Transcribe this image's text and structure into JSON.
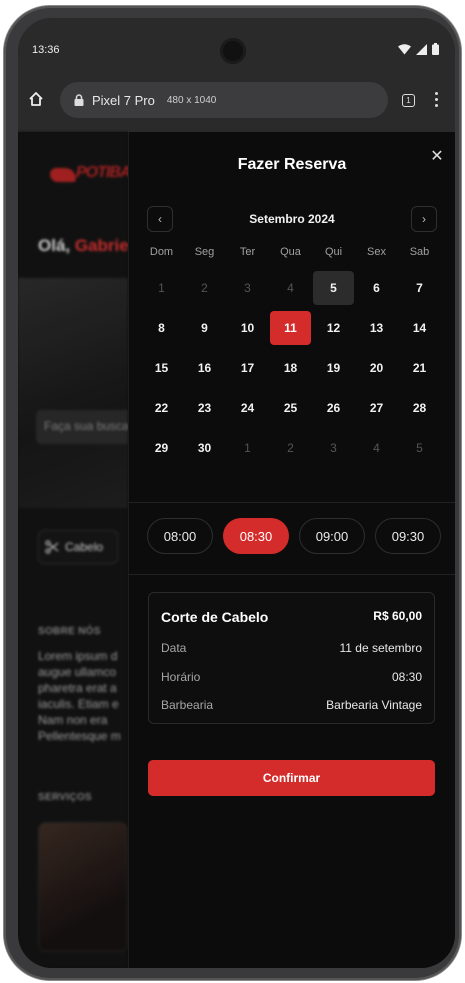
{
  "status_bar": {
    "time": "13:36"
  },
  "browser": {
    "device_name": "Pixel 7 Pro",
    "viewport": "480 x 1040",
    "tab_count": "1"
  },
  "background_page": {
    "logo": "POTIBA",
    "greeting": "Olá,",
    "user_name": "Gabrie",
    "search_placeholder": "Faça sua busca",
    "category": "Cabelo",
    "about_title": "SOBRE NÓS",
    "about_text": "Lorem ipsum d\naugue ullamco\npharetra erat a\niaculis. Etiam e\nNam non era\nPellentesque m",
    "services_title": "SERVIÇOS"
  },
  "sheet": {
    "title": "Fazer Reserva",
    "calendar": {
      "month": "Setembro 2024",
      "weekdays": [
        "Dom",
        "Seg",
        "Ter",
        "Qua",
        "Qui",
        "Sex",
        "Sab"
      ],
      "days": [
        {
          "d": "1",
          "state": "muted"
        },
        {
          "d": "2",
          "state": "muted"
        },
        {
          "d": "3",
          "state": "muted"
        },
        {
          "d": "4",
          "state": "muted"
        },
        {
          "d": "5",
          "state": "today"
        },
        {
          "d": "6",
          "state": ""
        },
        {
          "d": "7",
          "state": ""
        },
        {
          "d": "8",
          "state": ""
        },
        {
          "d": "9",
          "state": ""
        },
        {
          "d": "10",
          "state": ""
        },
        {
          "d": "11",
          "state": "sel"
        },
        {
          "d": "12",
          "state": ""
        },
        {
          "d": "13",
          "state": ""
        },
        {
          "d": "14",
          "state": ""
        },
        {
          "d": "15",
          "state": ""
        },
        {
          "d": "16",
          "state": ""
        },
        {
          "d": "17",
          "state": ""
        },
        {
          "d": "18",
          "state": ""
        },
        {
          "d": "19",
          "state": ""
        },
        {
          "d": "20",
          "state": ""
        },
        {
          "d": "21",
          "state": ""
        },
        {
          "d": "22",
          "state": ""
        },
        {
          "d": "23",
          "state": ""
        },
        {
          "d": "24",
          "state": ""
        },
        {
          "d": "25",
          "state": ""
        },
        {
          "d": "26",
          "state": ""
        },
        {
          "d": "27",
          "state": ""
        },
        {
          "d": "28",
          "state": ""
        },
        {
          "d": "29",
          "state": ""
        },
        {
          "d": "30",
          "state": ""
        },
        {
          "d": "1",
          "state": "muted"
        },
        {
          "d": "2",
          "state": "muted"
        },
        {
          "d": "3",
          "state": "muted"
        },
        {
          "d": "4",
          "state": "muted"
        },
        {
          "d": "5",
          "state": "muted"
        }
      ]
    },
    "times": [
      {
        "label": "08:00",
        "selected": false
      },
      {
        "label": "08:30",
        "selected": true
      },
      {
        "label": "09:00",
        "selected": false
      },
      {
        "label": "09:30",
        "selected": false
      }
    ],
    "summary": {
      "service": "Corte de Cabelo",
      "price": "R$ 60,00",
      "rows": [
        {
          "label": "Data",
          "value": "11 de setembro"
        },
        {
          "label": "Horário",
          "value": "08:30"
        },
        {
          "label": "Barbearia",
          "value": "Barbearia Vintage"
        }
      ]
    },
    "confirm_label": "Confirmar"
  },
  "colors": {
    "accent": "#d42b2b",
    "background": "#0c0c0c",
    "today_bg": "#2c2c2c"
  }
}
